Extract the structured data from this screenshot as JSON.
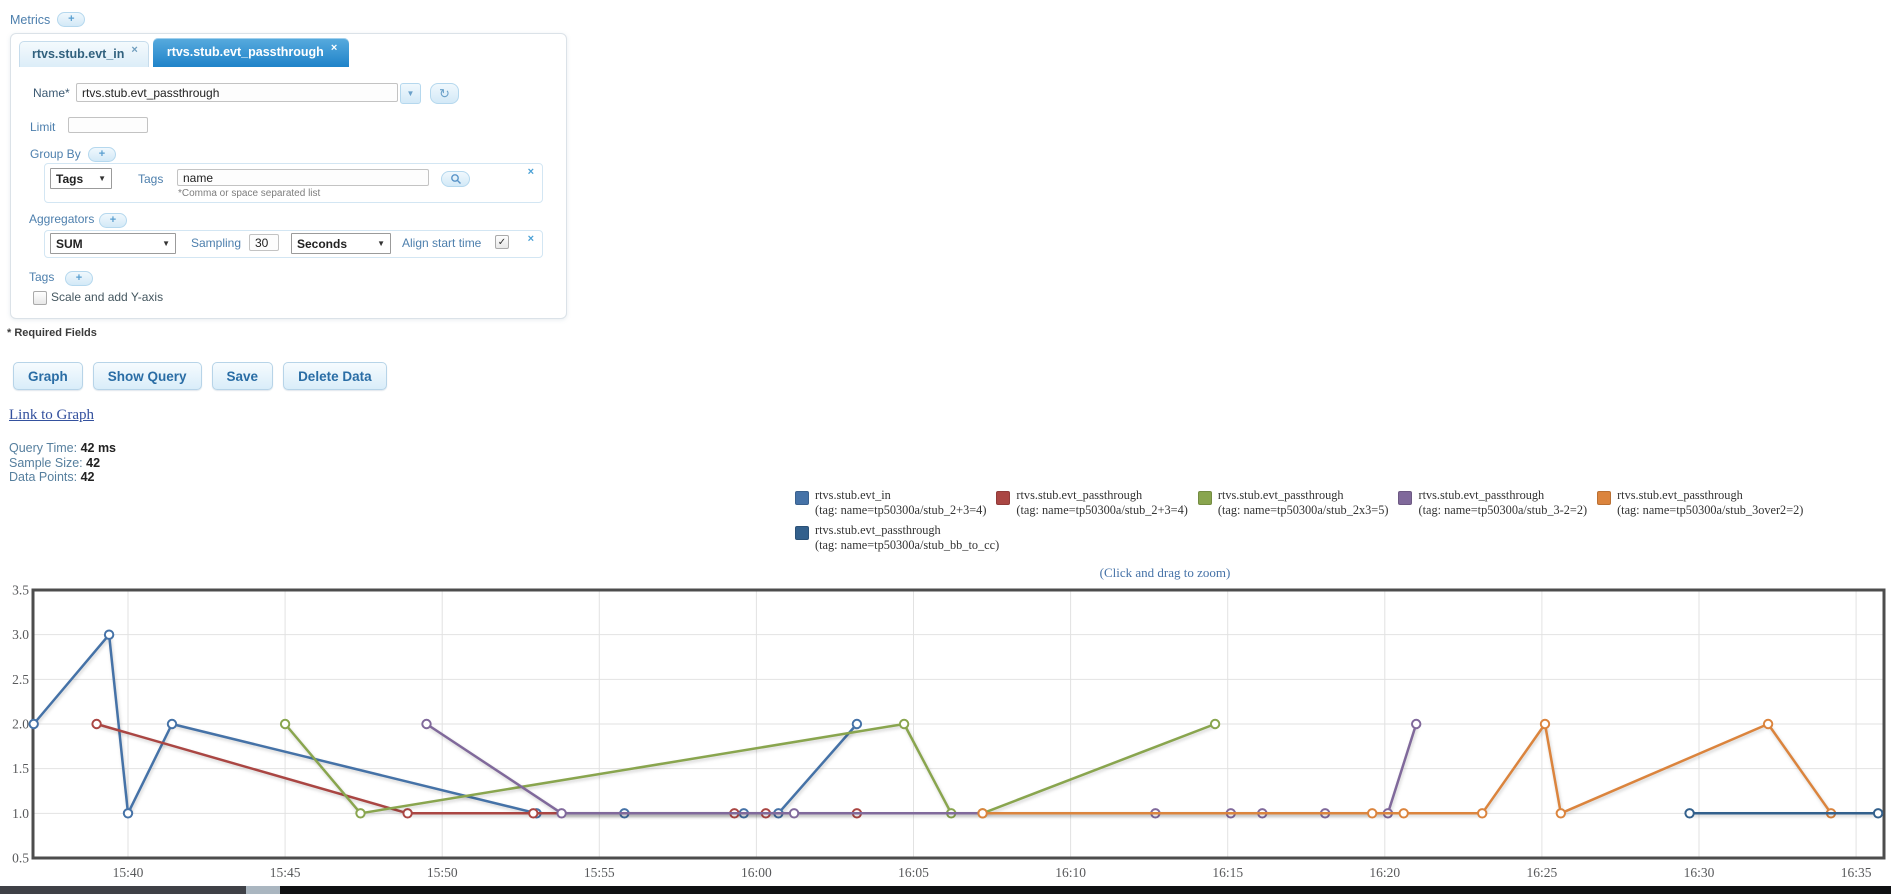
{
  "icons": {
    "plus": "+",
    "close": "×",
    "dropdown_arrow": "▼",
    "refresh": "↻",
    "check": "✓"
  },
  "metrics_section": {
    "label": "Metrics"
  },
  "tabs": [
    {
      "label": "rtvs.stub.evt_in",
      "active": false
    },
    {
      "label": "rtvs.stub.evt_passthrough",
      "active": true
    }
  ],
  "form": {
    "name": {
      "label": "Name*",
      "value": "rtvs.stub.evt_passthrough"
    },
    "limit": {
      "label": "Limit",
      "value": ""
    },
    "group_by": {
      "label": "Group By",
      "type_select": "Tags",
      "tags_label": "Tags",
      "tags_value": "name",
      "hint": "*Comma or space separated list"
    },
    "aggregators": {
      "label": "Aggregators",
      "fn_select": "SUM",
      "sampling_label": "Sampling",
      "sampling_value": "30",
      "unit_select": "Seconds",
      "align_label": "Align start time",
      "align_checked": true
    },
    "tags": {
      "label": "Tags"
    },
    "scale_checkbox": {
      "label": "Scale and add Y-axis",
      "checked": false
    },
    "required_note": "* Required Fields"
  },
  "actions": [
    {
      "label": "Graph"
    },
    {
      "label": "Show Query"
    },
    {
      "label": "Save"
    },
    {
      "label": "Delete Data"
    }
  ],
  "link_to_graph": "Link to Graph",
  "stats": [
    {
      "label": "Query Time:",
      "value": "42 ms"
    },
    {
      "label": "Sample Size:",
      "value": "42"
    },
    {
      "label": "Data Points:",
      "value": "42"
    }
  ],
  "chart_data": {
    "type": "line",
    "hint": "(Click and drag to zoom)",
    "x_unit": "minutes after 15:00",
    "ylim": [
      0.5,
      3.5
    ],
    "yticks": [
      0.5,
      1.0,
      1.5,
      2.0,
      2.5,
      3.0,
      3.5
    ],
    "xticks": [
      {
        "t": 40,
        "label": "15:40"
      },
      {
        "t": 45,
        "label": "15:45"
      },
      {
        "t": 50,
        "label": "15:50"
      },
      {
        "t": 55,
        "label": "15:55"
      },
      {
        "t": 60,
        "label": "16:00"
      },
      {
        "t": 65,
        "label": "16:05"
      },
      {
        "t": 70,
        "label": "16:10"
      },
      {
        "t": 75,
        "label": "16:15"
      },
      {
        "t": 80,
        "label": "16:20"
      },
      {
        "t": 85,
        "label": "16:25"
      },
      {
        "t": 90,
        "label": "16:30"
      },
      {
        "t": 95,
        "label": "16:35"
      }
    ],
    "series": [
      {
        "name": "rtvs.stub.evt_in",
        "tag": "(tag: name=tp50300a/stub_2+3=4)",
        "color": "#4572A7",
        "points": [
          [
            37,
            2
          ],
          [
            39.4,
            3
          ],
          [
            40,
            1
          ],
          [
            41.4,
            2
          ],
          [
            53,
            1
          ],
          [
            55.8,
            1
          ],
          [
            59.6,
            1
          ],
          [
            60.7,
            1
          ],
          [
            63.2,
            2
          ]
        ]
      },
      {
        "name": "rtvs.stub.evt_passthrough",
        "tag": "(tag: name=tp50300a/stub_2+3=4)",
        "color": "#AA4643",
        "points": [
          [
            39,
            2
          ],
          [
            48.9,
            1
          ],
          [
            52.9,
            1
          ],
          [
            59.3,
            1
          ],
          [
            60.3,
            1
          ],
          [
            63.2,
            1
          ]
        ]
      },
      {
        "name": "rtvs.stub.evt_passthrough",
        "tag": "(tag: name=tp50300a/stub_2x3=5)",
        "color": "#89A54E",
        "points": [
          [
            45,
            2
          ],
          [
            47.4,
            1
          ],
          [
            64.7,
            2
          ],
          [
            66.2,
            1
          ],
          [
            67.2,
            1
          ],
          [
            74.6,
            2
          ]
        ]
      },
      {
        "name": "rtvs.stub.evt_passthrough",
        "tag": "(tag: name=tp50300a/stub_3-2=2)",
        "color": "#80699B",
        "points": [
          [
            49.5,
            2
          ],
          [
            53.8,
            1
          ],
          [
            61.2,
            1
          ],
          [
            72.7,
            1
          ],
          [
            75.1,
            1
          ],
          [
            76.1,
            1
          ],
          [
            78.1,
            1
          ],
          [
            80.1,
            1
          ],
          [
            81,
            2
          ]
        ]
      },
      {
        "name": "rtvs.stub.evt_passthrough",
        "tag": "(tag: name=tp50300a/stub_3over2=2)",
        "color": "#DB843D",
        "points": [
          [
            67.2,
            1
          ],
          [
            79.6,
            1
          ],
          [
            80.6,
            1
          ],
          [
            83.1,
            1
          ],
          [
            85.1,
            2
          ],
          [
            85.6,
            1
          ],
          [
            92.2,
            2
          ],
          [
            94.2,
            1
          ]
        ]
      },
      {
        "name": "rtvs.stub.evt_passthrough",
        "tag": "(tag: name=tp50300a/stub_bb_to_cc)",
        "color": "#33608C",
        "points": [
          [
            89.7,
            1
          ],
          [
            95.7,
            1
          ]
        ]
      }
    ]
  }
}
